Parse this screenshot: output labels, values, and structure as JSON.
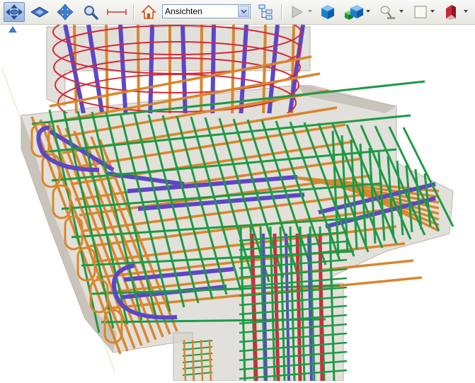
{
  "toolbar": {
    "tools": [
      {
        "name": "rotate-tool",
        "icon": "rotate-arrows-icon",
        "active": true
      },
      {
        "name": "pan-tool",
        "icon": "pan-icon",
        "active": false
      },
      {
        "name": "move-tool",
        "icon": "move-arrows-icon",
        "active": false
      },
      {
        "name": "zoom-tool",
        "icon": "magnifier-icon",
        "active": false
      },
      {
        "name": "measure-tool",
        "icon": "measure-line-icon",
        "active": false
      },
      {
        "name": "home-view",
        "icon": "home-icon",
        "active": false
      },
      {
        "name": "view-tree",
        "icon": "tree-icon",
        "active": false
      },
      {
        "name": "play",
        "icon": "play-icon",
        "active": false
      },
      {
        "name": "solid-display",
        "icon": "blue-cube-icon",
        "active": false
      },
      {
        "name": "display-mode",
        "icon": "cubes-icon",
        "active": false
      },
      {
        "name": "lighting",
        "icon": "lamp-icon",
        "active": false
      },
      {
        "name": "background",
        "icon": "white-square-icon",
        "active": false
      },
      {
        "name": "section",
        "icon": "section-plane-icon",
        "active": false
      }
    ],
    "view_select": {
      "selected": "Ansichten"
    }
  },
  "viewport": {
    "content": "3d-rebar-model",
    "colors": {
      "concrete": "#d9d6cf",
      "stirrups_green": "#1e9a46",
      "bars_orange": "#d9862c",
      "bars_purple": "#5c46c8",
      "bars_red": "#d22a3c",
      "background": "#ffffff"
    }
  }
}
